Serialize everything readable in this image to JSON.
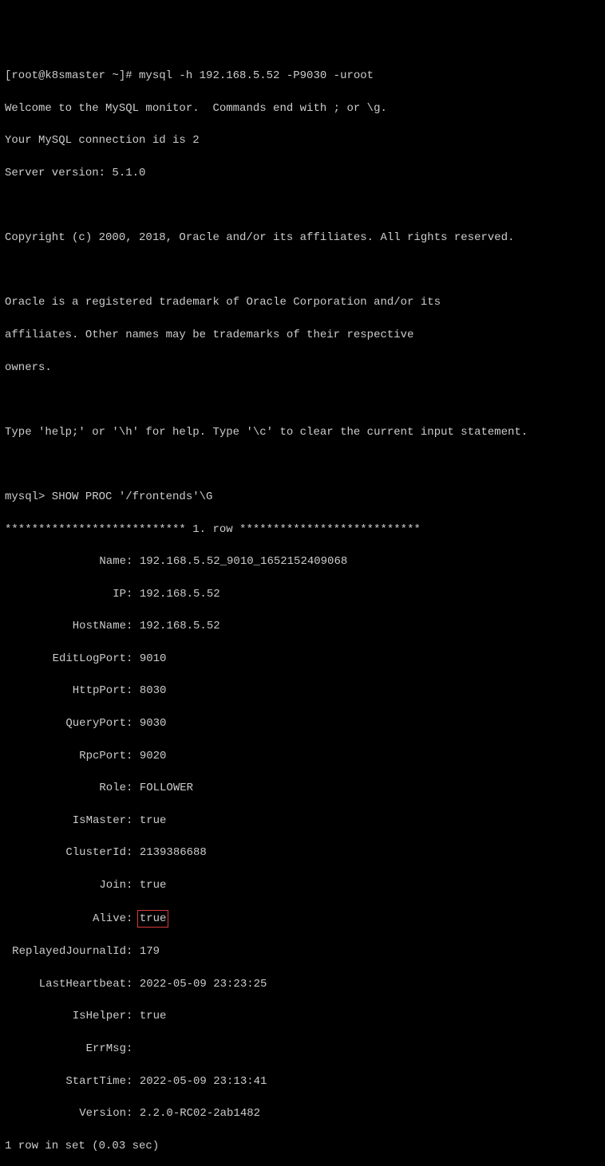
{
  "prompt_line": "[root@k8smaster ~]# mysql -h 192.168.5.52 -P9030 -uroot",
  "welcome": {
    "l1": "Welcome to the MySQL monitor.  Commands end with ; or \\g.",
    "l2": "Your MySQL connection id is 2",
    "l3": "Server version: 5.1.0"
  },
  "copyright": "Copyright (c) 2000, 2018, Oracle and/or its affiliates. All rights reserved.",
  "trademark": {
    "l1": "Oracle is a registered trademark of Oracle Corporation and/or its",
    "l2": "affiliates. Other names may be trademarks of their respective",
    "l3": "owners."
  },
  "help_line": "Type 'help;' or '\\h' for help. Type '\\c' to clear the current input statement.",
  "mysql_prompt": "mysql> SHOW PROC '/frontends'\\G",
  "row_header": "*************************** 1. row ***************************",
  "fields": {
    "Name": {
      "k": "Name",
      "v": "192.168.5.52_9010_1652152409068"
    },
    "IP": {
      "k": "IP",
      "v": "192.168.5.52"
    },
    "HostName": {
      "k": "HostName",
      "v": "192.168.5.52"
    },
    "EditLogPort": {
      "k": "EditLogPort",
      "v": "9010"
    },
    "HttpPort": {
      "k": "HttpPort",
      "v": "8030"
    },
    "QueryPort": {
      "k": "QueryPort",
      "v": "9030"
    },
    "RpcPort": {
      "k": "RpcPort",
      "v": "9020"
    },
    "Role": {
      "k": "Role",
      "v": "FOLLOWER"
    },
    "IsMaster": {
      "k": "IsMaster",
      "v": "true"
    },
    "ClusterId": {
      "k": "ClusterId",
      "v": "2139386688"
    },
    "Join": {
      "k": "Join",
      "v": "true"
    },
    "Alive": {
      "k": "Alive",
      "v": "true"
    },
    "ReplayedJournalId": {
      "k": "ReplayedJournalId",
      "v": "179"
    },
    "LastHeartbeat": {
      "k": "LastHeartbeat",
      "v": "2022-05-09 23:23:25"
    },
    "IsHelper": {
      "k": "IsHelper",
      "v": "true"
    },
    "ErrMsg": {
      "k": "ErrMsg",
      "v": ""
    },
    "StartTime": {
      "k": "StartTime",
      "v": "2022-05-09 23:13:41"
    },
    "Version": {
      "k": "Version",
      "v": "2.2.0-RC02-2ab1482"
    }
  },
  "footer": "1 row in set (0.03 sec)",
  "colon": ": "
}
